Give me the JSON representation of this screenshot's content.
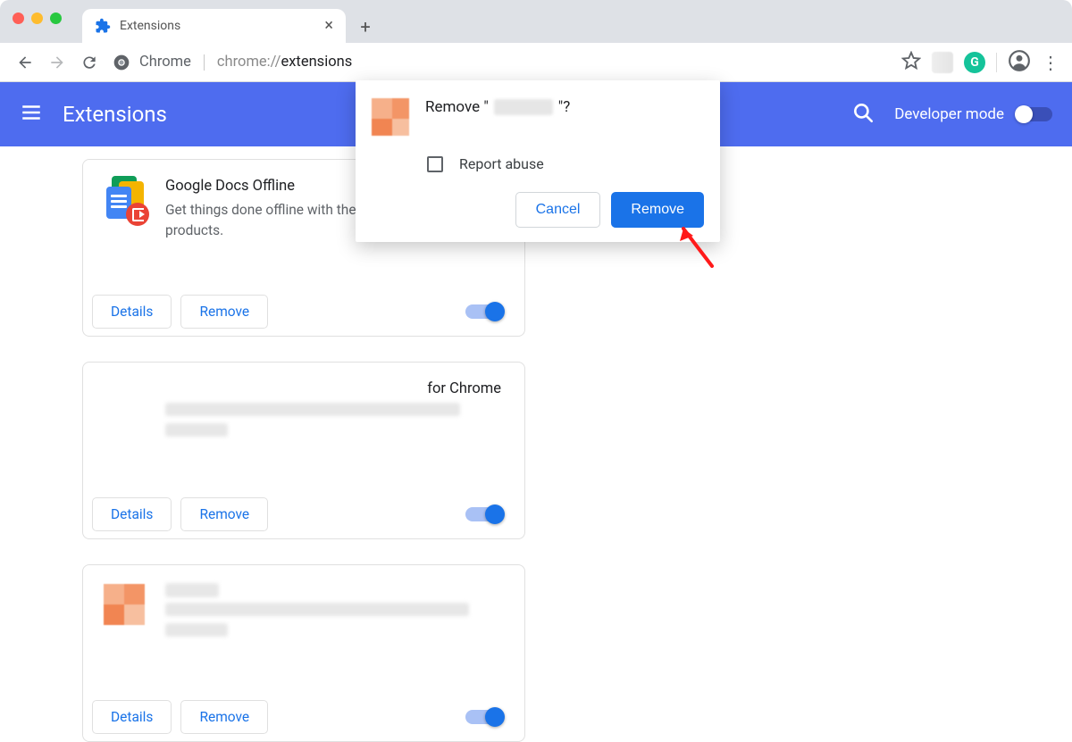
{
  "window": {
    "tab_title": "Extensions",
    "url_label": "Chrome",
    "url_prefix": "chrome://",
    "url_page": "extensions"
  },
  "header": {
    "title": "Extensions",
    "devmode_label": "Developer mode",
    "devmode_on": false
  },
  "cards": [
    {
      "title": "Google Docs Offline",
      "desc": "Get things done offline with the Google Docs family of products.",
      "details": "Details",
      "remove": "Remove",
      "enabled": true
    },
    {
      "title_suffix": " for Chrome",
      "details": "Details",
      "remove": "Remove",
      "enabled": true
    },
    {
      "details": "Details",
      "remove": "Remove",
      "enabled": true
    }
  ],
  "dialog": {
    "title_prefix": "Remove \"",
    "title_suffix": "\"?",
    "report_abuse": "Report abuse",
    "cancel": "Cancel",
    "remove": "Remove"
  },
  "grammarly_badge": "G"
}
